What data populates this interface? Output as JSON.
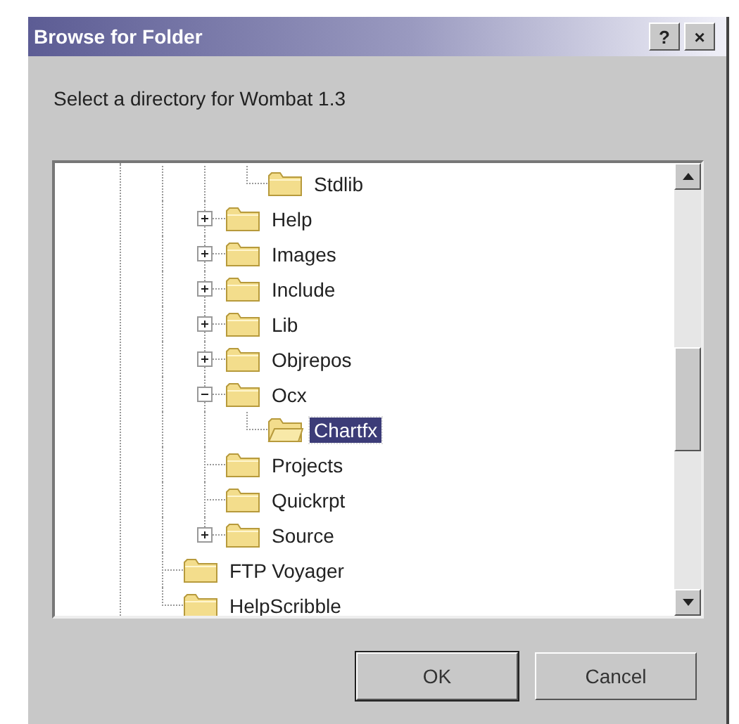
{
  "window": {
    "title": "Browse for Folder",
    "help_button": "?",
    "close_button": "×"
  },
  "prompt": "Select a directory for Wombat 1.3",
  "tree": {
    "items": [
      {
        "children": [
          {
            "children": [
              {
                "label": "Stdlib",
                "selected": false
              }
            ]
          },
          {
            "label": "Help",
            "expanded": false,
            "selected": false
          },
          {
            "label": "Images",
            "expanded": false,
            "selected": false
          },
          {
            "label": "Include",
            "expanded": false,
            "selected": false
          },
          {
            "label": "Lib",
            "expanded": false,
            "selected": false
          },
          {
            "label": "Objrepos",
            "expanded": false,
            "selected": false
          },
          {
            "label": "Ocx",
            "expanded": true,
            "selected": false,
            "children": [
              {
                "label": "Chartfx",
                "selected": true
              }
            ]
          },
          {
            "label": "Projects",
            "selected": false
          },
          {
            "label": "Quickrpt",
            "selected": false
          },
          {
            "label": "Source",
            "expanded": false,
            "selected": false
          }
        ]
      },
      {
        "label": "FTP Voyager",
        "selected": false
      },
      {
        "label": "HelpScribble",
        "selected": false
      }
    ]
  },
  "buttons": [
    {
      "label": "OK",
      "default": true
    },
    {
      "label": "Cancel",
      "default": false
    }
  ]
}
